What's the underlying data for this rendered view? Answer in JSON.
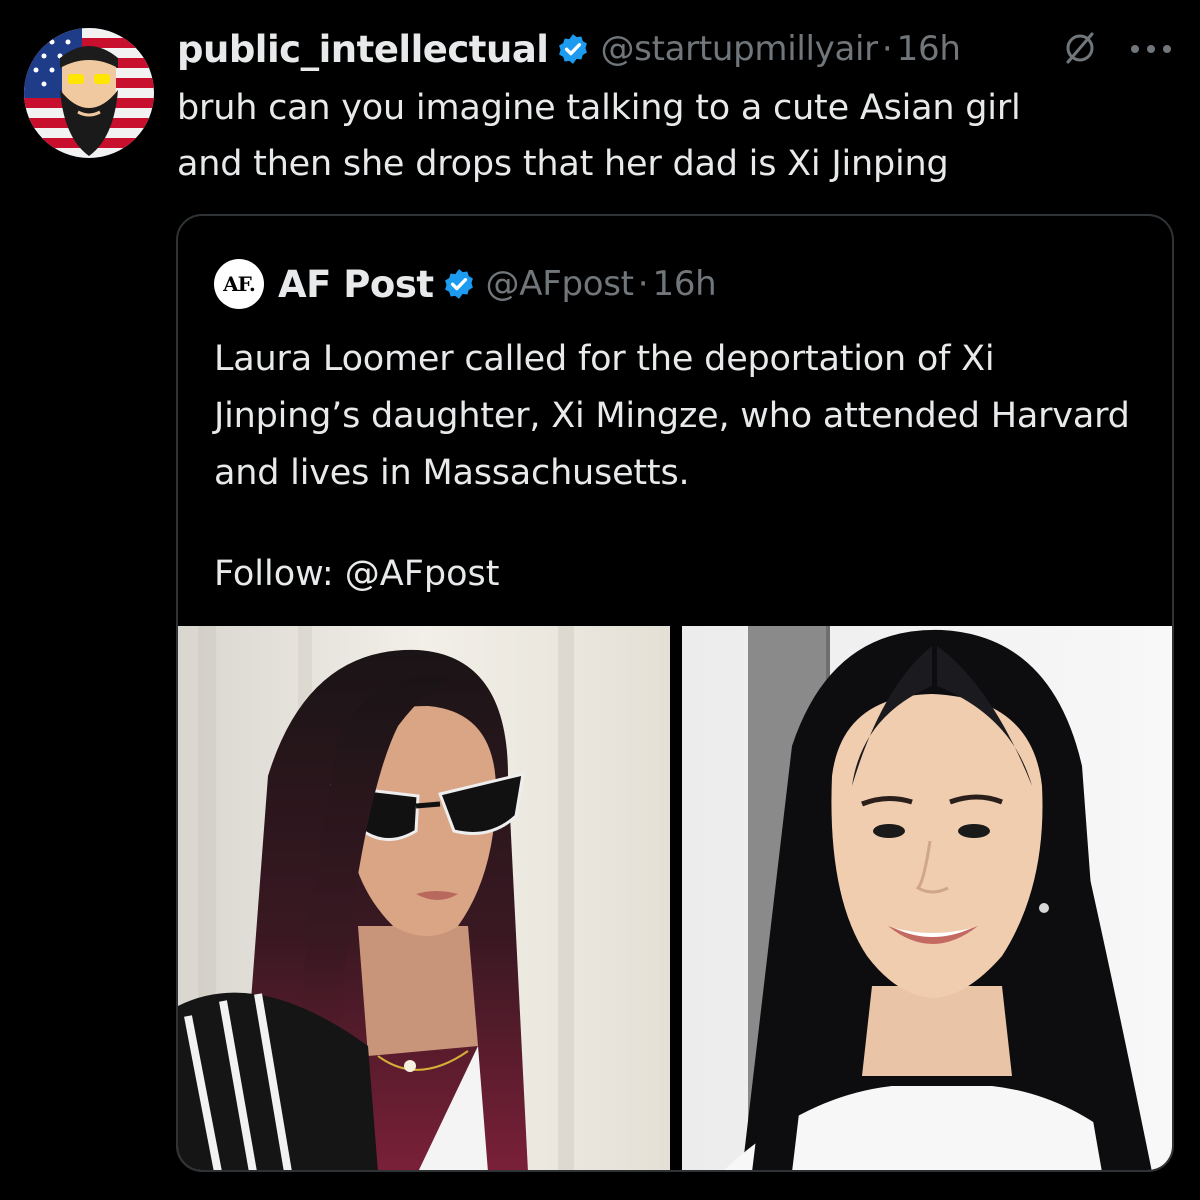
{
  "tweet": {
    "display_name": "public_intellectual",
    "handle": "@startupmillyair",
    "separator": "·",
    "time": "16h",
    "text": "bruh can you imagine talking to a cute Asian girl\nand then she drops that her dad is Xi Jinping",
    "avatar_icon": "bearded-man-flag-avatar",
    "verified_icon": "verified-badge-icon",
    "actions": [
      "grok-icon",
      "more-icon"
    ]
  },
  "quote": {
    "avatar_text": "AF.",
    "display_name": "AF Post",
    "handle": "@AFpost",
    "separator": "·",
    "time": "16h",
    "text": "Laura Loomer called for the deportation of Xi Jinping’s daughter, Xi Mingze, who attended Harvard and lives in Massachusetts.",
    "follow": "Follow: @AFpost",
    "images": [
      {
        "name": "woman-sunglasses-photo"
      },
      {
        "name": "young-woman-smiling-photo"
      }
    ]
  },
  "colors": {
    "background": "#000000",
    "text": "#e7e9ea",
    "secondary": "#71767b",
    "verified": "#1d9bf0",
    "border": "#2f3336"
  }
}
